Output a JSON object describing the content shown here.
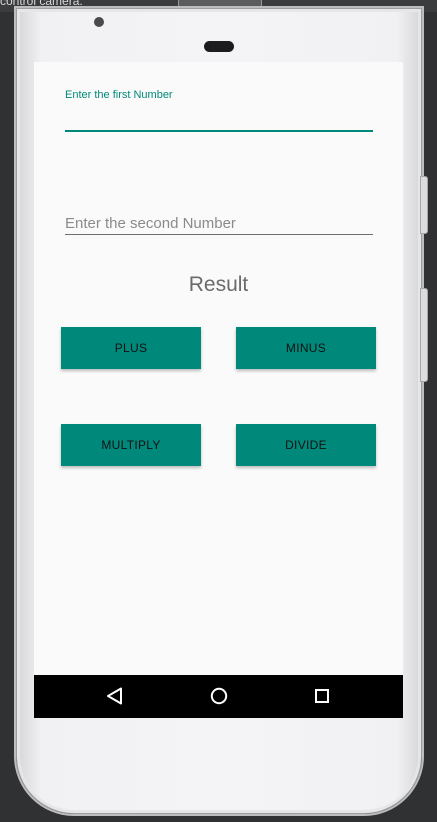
{
  "emulator": {
    "title": "control camera."
  },
  "form": {
    "first_label": "Enter the first Number",
    "first_value": "",
    "second_placeholder": "Enter the second Number",
    "second_value": ""
  },
  "result": {
    "text": "Result"
  },
  "buttons": {
    "plus": "PLUS",
    "minus": "MINUS",
    "multiply": "MULTIPLY",
    "divide": "DIVIDE"
  },
  "navbar": {
    "back_icon": "back-triangle-icon",
    "home_icon": "home-circle-icon",
    "recent_icon": "recent-square-icon"
  },
  "colors": {
    "accent": "#00897b",
    "screen_bg": "#fafafa",
    "navbar_bg": "#000000"
  }
}
